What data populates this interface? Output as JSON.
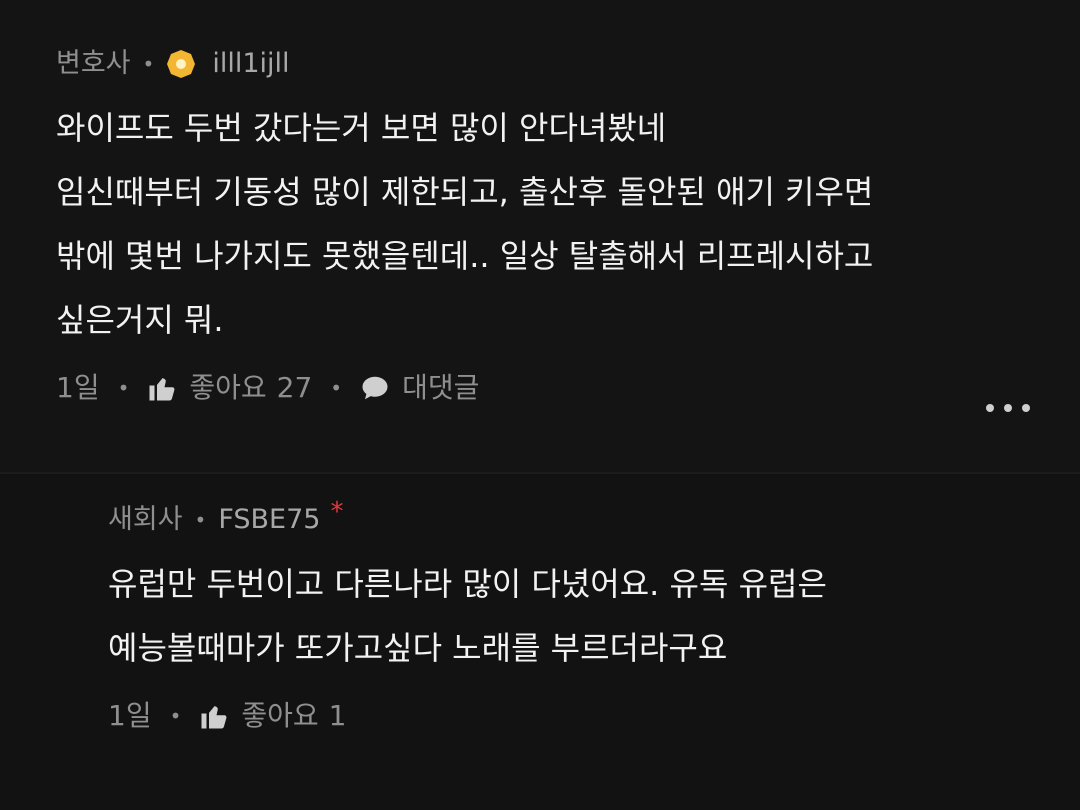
{
  "comments": [
    {
      "role": "변호사",
      "username": "illl1ijll",
      "badge_icon": "gold-badge-icon",
      "lines": [
        "와이프도 두번 갔다는거 보면 많이 안다녀봤네",
        "임신때부터 기동성 많이 제한되고, 출산후 돌안된 애기 키우면",
        "밖에 몇번 나가지도 못했을텐데.. 일상 탈출해서 리프레시하고",
        "싶은거지 뭐."
      ],
      "time": "1일",
      "like_label": "좋아요",
      "like_count": "27",
      "reply_label": "대댓글"
    },
    {
      "role": "새회사",
      "username": "FSBE75",
      "author_mark": "*",
      "lines": [
        "유럽만 두번이고 다른나라 많이 다녔어요. 유독 유럽은",
        "예능볼때마가 또가고싶다 노래를 부르더라구요"
      ],
      "time": "1일",
      "like_label": "좋아요",
      "like_count": "1"
    }
  ],
  "colors": {
    "background": "#121212",
    "badge": "#f2b632",
    "star": "#e5383b"
  }
}
